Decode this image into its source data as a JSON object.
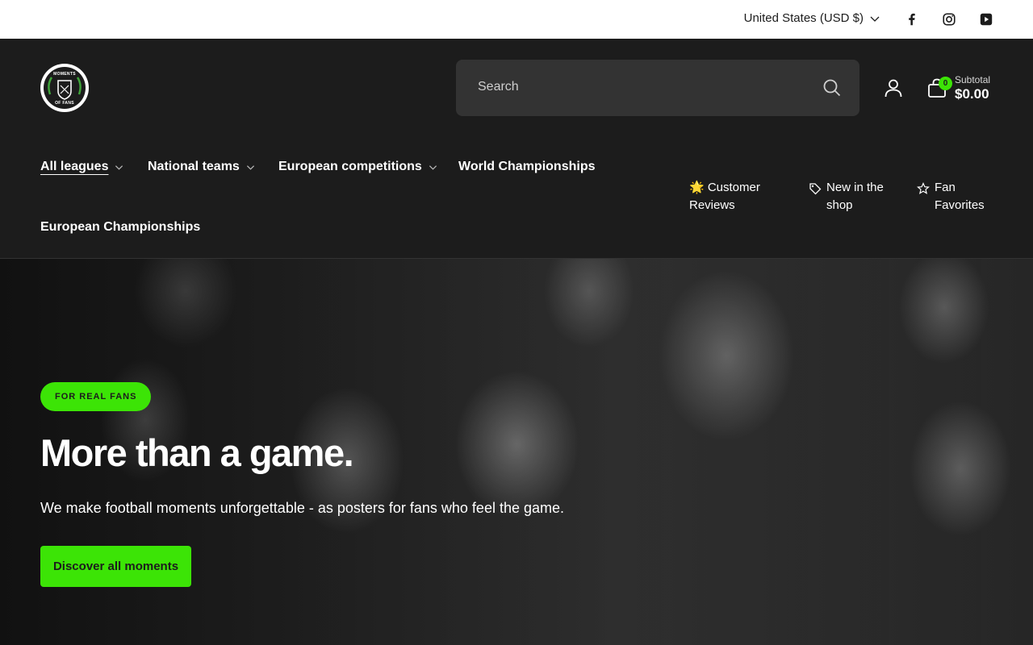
{
  "topbar": {
    "currency": "United States (USD $)",
    "social": [
      "facebook-icon",
      "instagram-icon",
      "youtube-icon"
    ]
  },
  "header": {
    "logo_text_top": "MOMENTS",
    "logo_text_bottom": "OF FANS",
    "search_placeholder": "Search",
    "cart_count": "0",
    "subtotal_label": "Subtotal",
    "subtotal_value": "$0.00"
  },
  "nav": {
    "items": [
      {
        "label": "All leagues",
        "dropdown": true,
        "active": true
      },
      {
        "label": "National teams",
        "dropdown": true
      },
      {
        "label": "European competitions",
        "dropdown": true
      },
      {
        "label": "World Championships",
        "dropdown": false
      },
      {
        "label": "European Championships",
        "dropdown": false
      }
    ],
    "quick_links": [
      {
        "icon": "star-emoji-icon",
        "line1": "🌟 Customer",
        "line2": "Reviews"
      },
      {
        "icon": "tag-icon",
        "line1": "New in the",
        "line2": "shop"
      },
      {
        "icon": "star-outline-icon",
        "line1": "Fan",
        "line2": "Favorites"
      }
    ]
  },
  "hero": {
    "badge": "FOR REAL FANS",
    "title": "More than a game.",
    "subtitle": "We make football moments unforgettable - as posters for fans who feel the game.",
    "cta": "Discover all moments"
  },
  "colors": {
    "accent": "#3ce406",
    "header_bg": "#1c1c1c",
    "search_bg": "#333333"
  }
}
